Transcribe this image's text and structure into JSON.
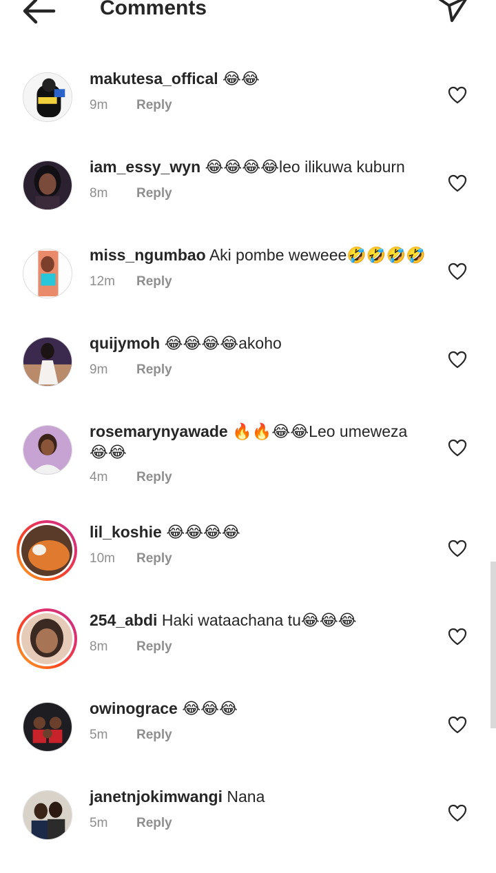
{
  "header": {
    "title": "Comments"
  },
  "comments": [
    {
      "username": "makutesa_offical",
      "text": " 😂😂",
      "time": "9m",
      "reply": "Reply"
    },
    {
      "username": "iam_essy_wyn",
      "text": " 😂😂😂😂leo ilikuwa kuburn",
      "time": "8m",
      "reply": "Reply"
    },
    {
      "username": "miss_ngumbao",
      "text": " Aki pombe weweee🤣🤣🤣🤣",
      "time": "12m",
      "reply": "Reply"
    },
    {
      "username": "quijymoh",
      "text": " 😂😂😂😂akoho",
      "time": "9m",
      "reply": "Reply"
    },
    {
      "username": "rosemarynyawade",
      "text": " 🔥🔥😂😂Leo umeweza 😂😂",
      "time": "4m",
      "reply": "Reply"
    },
    {
      "username": "lil_koshie",
      "text": " 😂😂😂😂",
      "time": "10m",
      "reply": "Reply"
    },
    {
      "username": "254_abdi",
      "text": " Haki wataachana tu😂😂😂",
      "time": "8m",
      "reply": "Reply"
    },
    {
      "username": "owinograce",
      "text": " 😂😂😂",
      "time": "5m",
      "reply": "Reply"
    },
    {
      "username": "janetnjokimwangi",
      "text": " Nana",
      "time": "5m",
      "reply": "Reply"
    }
  ],
  "colors": {
    "text": "#262626",
    "secondary": "#8e8e8e",
    "story_ring_start": "#f7b733",
    "story_ring_end": "#c13584"
  }
}
